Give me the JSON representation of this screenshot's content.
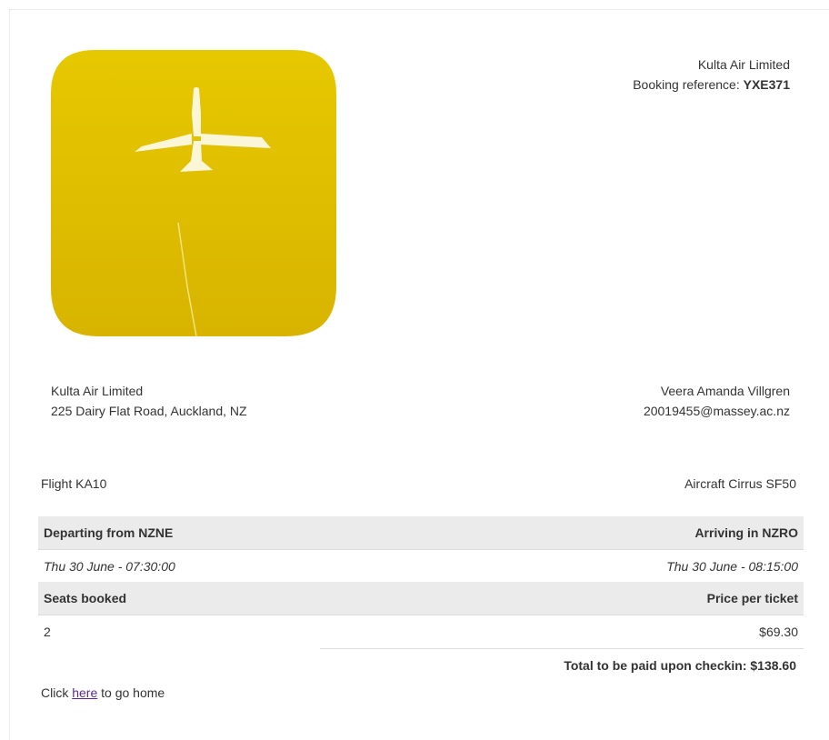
{
  "header": {
    "company": "Kulta Air Limited",
    "booking_reference_label": "Booking reference: ",
    "booking_reference": "YXE371"
  },
  "logo": {
    "icon": "airplane-icon",
    "color": "#e3c300"
  },
  "company_address": {
    "name": "Kulta Air Limited",
    "address": "225 Dairy Flat Road, Auckland, NZ"
  },
  "customer": {
    "name": "Veera Amanda Villgren",
    "email": "20019455@massey.ac.nz"
  },
  "flight": {
    "number": "Flight KA10",
    "aircraft": "Aircraft Cirrus SF50"
  },
  "table": {
    "departing_header": "Departing from NZNE",
    "arriving_header": "Arriving in NZRO",
    "departing_time": "Thu 30 June - 07:30:00",
    "arriving_time": "Thu 30 June - 08:15:00",
    "seats_header": "Seats booked",
    "price_header": "Price per ticket",
    "seats_value": "2",
    "price_value": "$69.30"
  },
  "total": "Total to be paid upon checkin: $138.60",
  "footer": {
    "prefix": "Click ",
    "link": "here",
    "suffix": " to go home"
  }
}
